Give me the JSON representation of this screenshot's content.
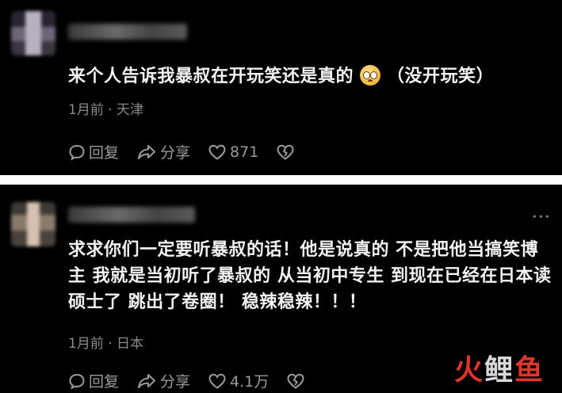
{
  "comments": [
    {
      "text": "来个人告诉我暴叔在开玩笑还是真的",
      "text_suffix": "（没开玩笑）",
      "meta": "1月前 · 天津",
      "actions": {
        "reply": "回复",
        "share": "分享",
        "likes": "871"
      }
    },
    {
      "text_lines": [
        "求求你们一定要听暴叔的话！他是说真的 不是把他当搞笑博",
        "主 我就是当初听了暴叔的 从当初中专生 到现在已经在日本读",
        "硕士了 跳出了卷圈！ 稳辣稳辣！！！"
      ],
      "meta": "1月前 · 日本",
      "actions": {
        "reply": "回复",
        "share": "分享",
        "likes": "4.1万"
      }
    }
  ],
  "watermark": {
    "part1": "火",
    "part2": "鲤",
    "part3": "鱼"
  },
  "colors": {
    "background": "#000000",
    "text": "#f2f2f2",
    "meta": "#8a8a8a",
    "watermark_red": "#e0352b"
  }
}
